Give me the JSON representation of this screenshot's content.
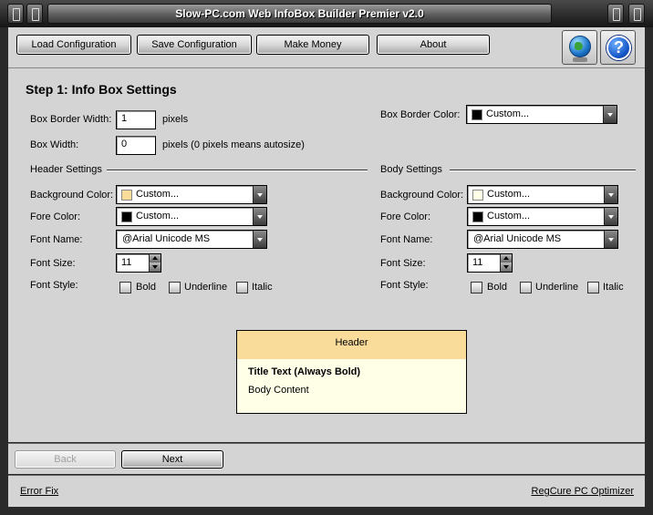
{
  "window": {
    "title": "Slow-PC.com Web InfoBox Builder Premier v2.0"
  },
  "toolbar": {
    "buttons": [
      "Load Configuration",
      "Save Configuration",
      "Make Money",
      "About"
    ],
    "globe_icon": "globe-icon",
    "help_icon": "help-icon",
    "help_glyph": "?"
  },
  "step": {
    "title": "Step 1: Info Box Settings"
  },
  "box": {
    "border_width_label": "Box Border Width:",
    "border_width_value": "1",
    "border_width_unit": "pixels",
    "width_label": "Box Width:",
    "width_value": "0",
    "width_unit": "pixels (0 pixels means autosize)",
    "border_color_label": "Box Border Color:",
    "border_color_value": "Custom...",
    "border_color_swatch": "#000000"
  },
  "header_settings": {
    "section_label": "Header Settings",
    "bg_color_label": "Background Color:",
    "bg_color_value": "Custom...",
    "bg_color_swatch": "#f9dc9a",
    "fore_color_label": "Fore Color:",
    "fore_color_value": "Custom...",
    "fore_color_swatch": "#000000",
    "font_name_label": "Font Name:",
    "font_name_value": "@Arial Unicode MS",
    "font_size_label": "Font Size:",
    "font_size_value": "11",
    "font_style_label": "Font Style:",
    "bold_label": "Bold",
    "underline_label": "Underline",
    "italic_label": "Italic",
    "bold_checked": false,
    "underline_checked": false,
    "italic_checked": false
  },
  "body_settings": {
    "section_label": "Body Settings",
    "bg_color_label": "Background Color:",
    "bg_color_value": "Custom...",
    "bg_color_swatch": "#ffffe8",
    "fore_color_label": "Fore Color:",
    "fore_color_value": "Custom...",
    "fore_color_swatch": "#000000",
    "font_name_label": "Font Name:",
    "font_name_value": "@Arial Unicode MS",
    "font_size_label": "Font Size:",
    "font_size_value": "11",
    "font_style_label": "Font Style:",
    "bold_label": "Bold",
    "underline_label": "Underline",
    "italic_label": "Italic",
    "bold_checked": false,
    "underline_checked": false,
    "italic_checked": false
  },
  "preview": {
    "header_text": "Header",
    "title_text": "Title Text (Always Bold)",
    "body_text": "Body Content"
  },
  "nav": {
    "back_label": "Back",
    "back_enabled": false,
    "next_label": "Next"
  },
  "footer": {
    "left_link": "Error Fix",
    "right_link": "RegCure PC Optimizer"
  }
}
